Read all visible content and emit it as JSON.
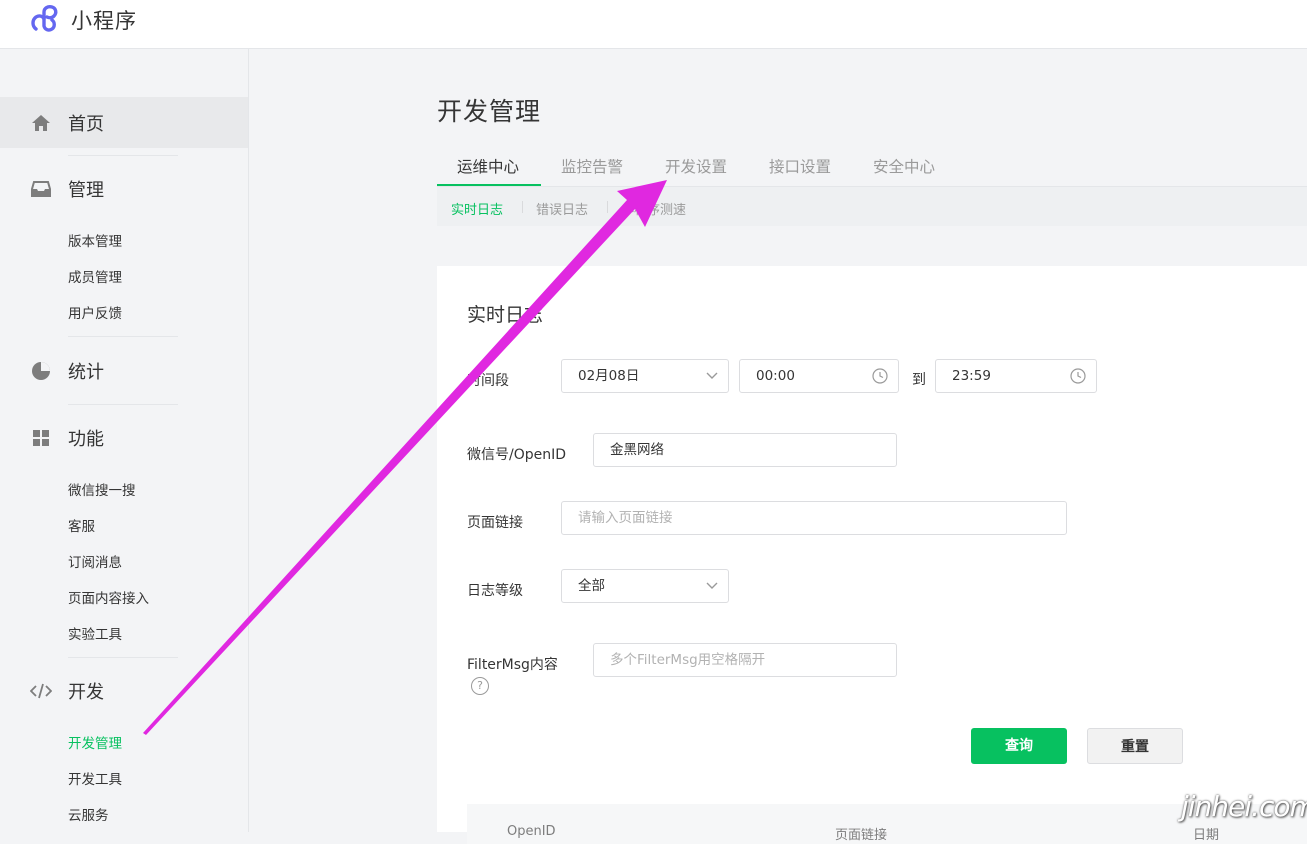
{
  "header": {
    "app_name": "小程序"
  },
  "sidebar": {
    "home": "首页",
    "manage": {
      "label": "管理",
      "items": [
        "版本管理",
        "成员管理",
        "用户反馈"
      ]
    },
    "stats": "统计",
    "features": {
      "label": "功能",
      "items": [
        "微信搜一搜",
        "客服",
        "订阅消息",
        "页面内容接入",
        "实验工具"
      ]
    },
    "dev": {
      "label": "开发",
      "items": [
        "开发管理",
        "开发工具",
        "云服务"
      ]
    }
  },
  "page": {
    "title": "开发管理",
    "tabs": [
      "运维中心",
      "监控告警",
      "开发设置",
      "接口设置",
      "安全中心"
    ],
    "subtabs": [
      "实时日志",
      "错误日志",
      "小程序测速"
    ]
  },
  "panel": {
    "title": "实时日志",
    "time_label": "时间段",
    "date_value": "02月08日",
    "start_time": "00:00",
    "to_label": "到",
    "end_time": "23:59",
    "openid_label": "微信号/OpenID",
    "openid_value": "金黑网络",
    "page_link_label": "页面链接",
    "page_link_placeholder": "请输入页面链接",
    "level_label": "日志等级",
    "level_value": "全部",
    "filter_label": "FilterMsg内容",
    "filter_placeholder": "多个FilterMsg用空格隔开",
    "help_glyph": "?",
    "query_button": "查询",
    "reset_button": "重置",
    "table_headers": [
      "OpenID",
      "页面链接",
      "日期"
    ]
  },
  "watermark": "jinhei.com",
  "colors": {
    "accent": "#07c160",
    "annotation_arrow": "#e028e0"
  }
}
